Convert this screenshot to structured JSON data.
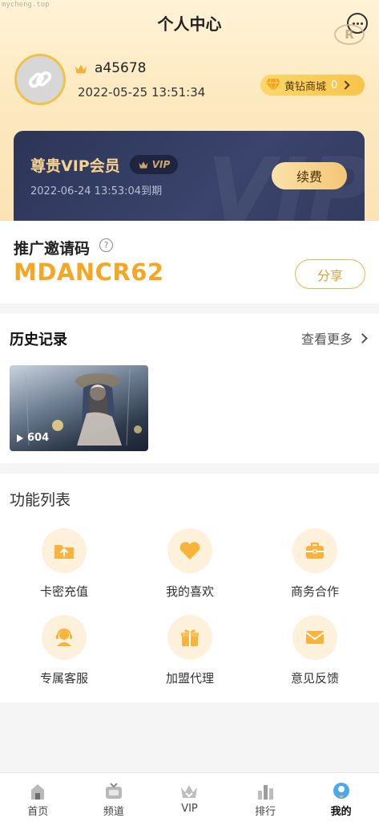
{
  "watermark": "mycheng.top",
  "header": {
    "title": "个人中心",
    "r_mark": "R"
  },
  "profile": {
    "username": "a45678",
    "registered": "2022-05-25 13:51:34"
  },
  "mall": {
    "label": "黄钻商城",
    "count": "0"
  },
  "vip": {
    "title": "尊贵VIP会员",
    "badge": "VIP",
    "expiry": "2022-06-24 13:53:04到期",
    "renew_label": "续费",
    "bg_text": "VIP"
  },
  "invite": {
    "title": "推广邀请码",
    "help_glyph": "?",
    "code": "MDANCR62",
    "share_label": "分享"
  },
  "history": {
    "title": "历史记录",
    "more_label": "查看更多",
    "items": [
      {
        "views": "604"
      }
    ]
  },
  "features": {
    "title": "功能列表",
    "items": [
      {
        "label": "卡密充值",
        "icon": "upload-folder-icon"
      },
      {
        "label": "我的喜欢",
        "icon": "heart-icon"
      },
      {
        "label": "商务合作",
        "icon": "briefcase-icon"
      },
      {
        "label": "专属客服",
        "icon": "headset-icon"
      },
      {
        "label": "加盟代理",
        "icon": "gift-icon"
      },
      {
        "label": "意见反馈",
        "icon": "mail-icon"
      }
    ]
  },
  "nav": {
    "items": [
      {
        "label": "首页",
        "icon": "home-icon"
      },
      {
        "label": "频道",
        "icon": "tv-icon"
      },
      {
        "label": "VIP",
        "icon": "crown-icon"
      },
      {
        "label": "排行",
        "icon": "ranking-icon"
      },
      {
        "label": "我的",
        "icon": "profile-icon",
        "active": true
      }
    ]
  },
  "colors": {
    "accent": "#f5a623",
    "vip_gold": "#f6d190",
    "vip_card": "#2c3557"
  }
}
